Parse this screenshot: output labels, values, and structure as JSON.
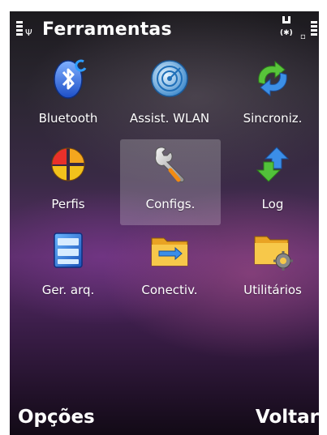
{
  "status_bar": {
    "title": "Ferramentas",
    "bluetooth_indicator": "(✱)",
    "signal_icon": "signal-bars-icon",
    "battery_icon": "battery-bars-icon"
  },
  "apps": [
    {
      "label": "Bluetooth",
      "icon": "bluetooth-icon",
      "selected": false
    },
    {
      "label": "Assist. WLAN",
      "icon": "wlan-wizard-icon",
      "selected": false
    },
    {
      "label": "Sincroniz.",
      "icon": "sync-icon",
      "selected": false
    },
    {
      "label": "Perfis",
      "icon": "profiles-icon",
      "selected": false
    },
    {
      "label": "Configs.",
      "icon": "settings-wrench-icon",
      "selected": true
    },
    {
      "label": "Log",
      "icon": "log-arrows-icon",
      "selected": false
    },
    {
      "label": "Ger. arq.",
      "icon": "file-manager-icon",
      "selected": false
    },
    {
      "label": "Conectiv.",
      "icon": "connectivity-folder-icon",
      "selected": false
    },
    {
      "label": "Utilitários",
      "icon": "utilities-folder-icon",
      "selected": false
    }
  ],
  "softkeys": {
    "left": "Opções",
    "right": "Voltar"
  }
}
